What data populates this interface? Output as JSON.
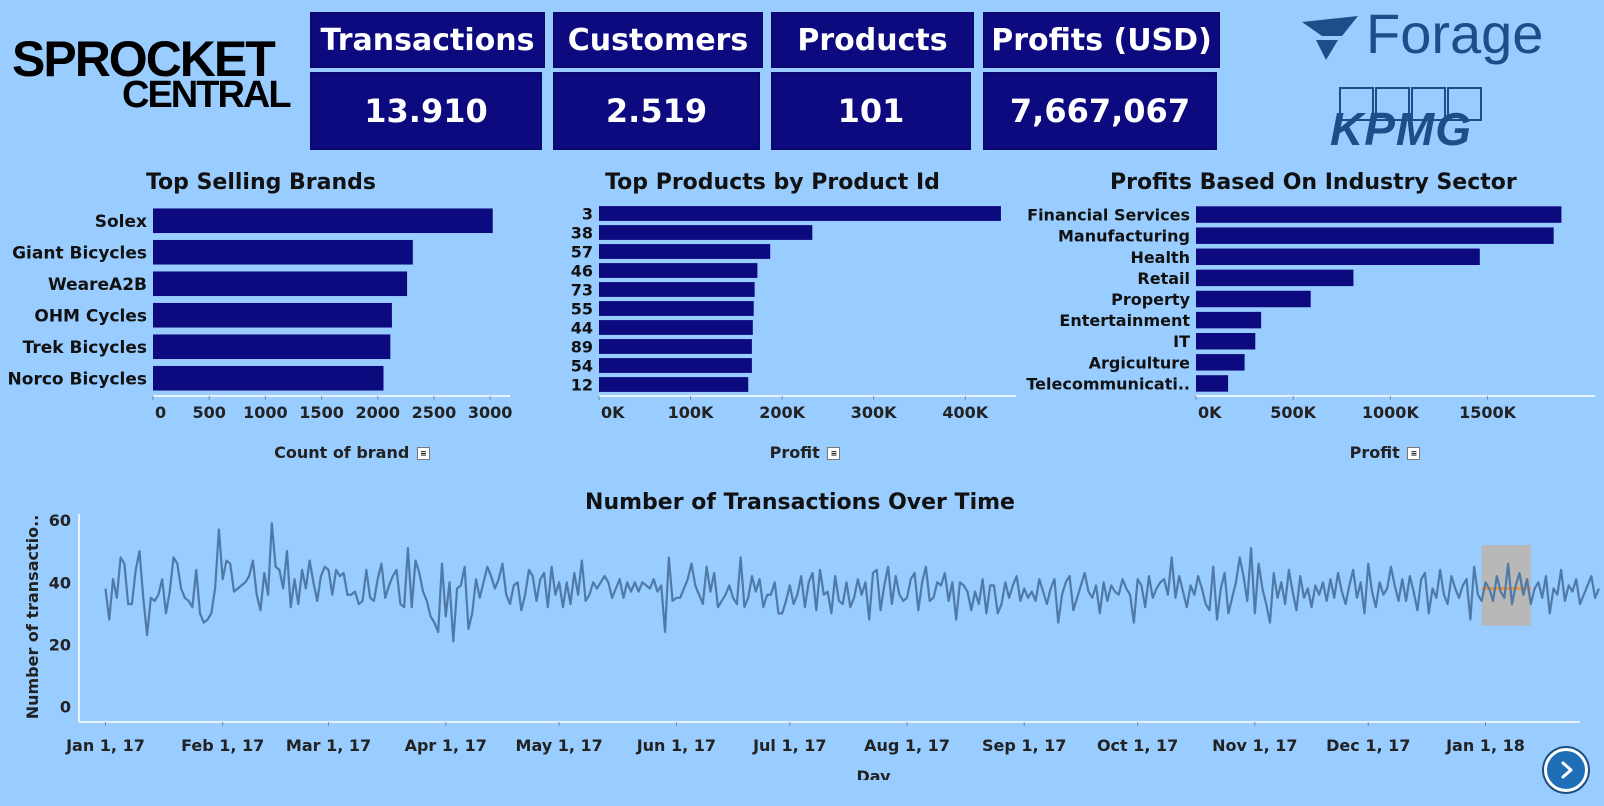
{
  "brand": {
    "line1": "SPROCKET",
    "line2": "CENTRAL",
    "forage": "Forage",
    "kpmg": "KPMG"
  },
  "kpis": [
    {
      "label": "Transactions",
      "value": "13.910"
    },
    {
      "label": "Customers",
      "value": "2.519"
    },
    {
      "label": "Products",
      "value": "101"
    },
    {
      "label": "Profits (USD)",
      "value": "7,667,067"
    }
  ],
  "colors": {
    "background": "#99ccff",
    "bar": "#0d0a80",
    "line": "#4f7aa6",
    "forecast_band": "#b8b8b8",
    "forecast_line": "#f28e2b"
  },
  "icons": {
    "nav": "chevron-right-icon",
    "sort": "sort-icon"
  },
  "chart_data": [
    {
      "type": "bar",
      "title": "Top Selling Brands",
      "xlabel": "Count of brand",
      "categories": [
        "Solex",
        "Giant Bicycles",
        "WeareA2B",
        "OHM Cycles",
        "Trek Bicycles",
        "Norco Bicycles"
      ],
      "values": [
        3023,
        2312,
        2261,
        2126,
        2112,
        2051
      ],
      "xlim": [
        0,
        3150
      ],
      "ticks": [
        0,
        500,
        1000,
        1500,
        2000,
        2500,
        3000
      ],
      "tick_labels": [
        "0",
        "500",
        "1000",
        "1500",
        "2000",
        "2500",
        "3000"
      ],
      "grid": false
    },
    {
      "type": "bar",
      "title": "Top Products by Product Id",
      "xlabel": "Profit",
      "categories": [
        "3",
        "38",
        "57",
        "46",
        "73",
        "55",
        "44",
        "89",
        "54",
        "12"
      ],
      "values": [
        439000,
        233000,
        187000,
        173000,
        170000,
        169000,
        168000,
        167000,
        167000,
        163000
      ],
      "xlim": [
        0,
        450000
      ],
      "ticks": [
        0,
        100000,
        200000,
        300000,
        400000
      ],
      "tick_labels": [
        "0K",
        "100K",
        "200K",
        "300K",
        "400K"
      ],
      "grid": false
    },
    {
      "type": "bar",
      "title": "Profits Based On Industry Sector",
      "xlabel": "Profit",
      "categories": [
        "Financial Services",
        "Manufacturing",
        "Health",
        "Retail",
        "Property",
        "Entertainment",
        "IT",
        "Argiculture",
        "Telecommunicati.."
      ],
      "values": [
        1880000,
        1840000,
        1460000,
        810000,
        590000,
        335000,
        305000,
        250000,
        165000
      ],
      "xlim": [
        0,
        1960000
      ],
      "ticks": [
        0,
        500000,
        1000000,
        1500000
      ],
      "tick_labels": [
        "0K",
        "500K",
        "1000K",
        "1500K"
      ],
      "grid": false
    },
    {
      "type": "line",
      "title": "Number of Transactions Over Time",
      "xlabel": "Day",
      "ylabel": "Number of transactio..",
      "ylim": [
        -5,
        62
      ],
      "yticks": [
        0,
        20,
        40,
        60
      ],
      "x_start": "2017-01-01",
      "x_tick_labels": [
        "Jan 1, 17",
        "Feb 1, 17",
        "Mar 1, 17",
        "Apr 1, 17",
        "May 1, 17",
        "Jun 1, 17",
        "Jul 1, 17",
        "Aug 1, 17",
        "Sep 1, 17",
        "Oct 1, 17",
        "Nov 1, 17",
        "Dec 1, 17",
        "Jan 1, 18"
      ],
      "x_tick_days": [
        0,
        31,
        59,
        90,
        120,
        151,
        181,
        212,
        243,
        273,
        304,
        334,
        365
      ],
      "xlim_days": [
        -7,
        390
      ],
      "forecast": {
        "start_day": 364,
        "end_day": 377,
        "value": 38,
        "low": 26,
        "high": 52
      },
      "values": [
        38,
        28,
        41,
        35,
        48,
        46,
        33,
        33,
        44,
        50,
        35,
        23,
        35,
        34,
        36,
        41,
        30,
        37,
        48,
        46,
        38,
        35,
        34,
        32,
        44,
        30,
        27,
        28,
        30,
        38,
        57,
        41,
        47,
        46,
        37,
        38,
        39,
        40,
        42,
        47,
        36,
        31,
        43,
        36,
        59,
        45,
        44,
        38,
        50,
        32,
        41,
        33,
        44,
        38,
        47,
        40,
        34,
        42,
        45,
        44,
        36,
        44,
        42,
        43,
        36,
        36,
        37,
        33,
        34,
        44,
        35,
        34,
        41,
        46,
        35,
        39,
        42,
        44,
        33,
        32,
        51,
        32,
        47,
        43,
        37,
        34,
        29,
        27,
        24,
        46,
        29,
        40,
        21,
        38,
        39,
        45,
        25,
        30,
        41,
        35,
        40,
        45,
        42,
        38,
        41,
        46,
        36,
        33,
        39,
        40,
        31,
        36,
        44,
        42,
        34,
        41,
        43,
        32,
        45,
        36,
        40,
        32,
        40,
        33,
        43,
        36,
        47,
        34,
        36,
        40,
        38,
        40,
        42,
        40,
        35,
        38,
        41,
        35,
        40,
        37,
        40,
        37,
        40,
        39,
        38,
        41,
        37,
        39,
        24,
        48,
        34,
        35,
        35,
        38,
        41,
        46,
        39,
        36,
        33,
        45,
        37,
        43,
        32,
        34,
        36,
        39,
        35,
        33,
        48,
        32,
        35,
        42,
        37,
        41,
        32,
        36,
        36,
        40,
        30,
        30,
        34,
        39,
        33,
        36,
        42,
        32,
        40,
        43,
        31,
        44,
        36,
        37,
        30,
        42,
        34,
        33,
        40,
        32,
        35,
        41,
        36,
        40,
        28,
        43,
        44,
        31,
        39,
        45,
        33,
        42,
        36,
        34,
        35,
        41,
        43,
        31,
        40,
        45,
        34,
        35,
        40,
        39,
        43,
        34,
        40,
        28,
        40,
        39,
        37,
        31,
        37,
        33,
        41,
        30,
        39,
        39,
        30,
        33,
        40,
        35,
        39,
        42,
        34,
        38,
        35,
        37,
        34,
        41,
        37,
        33,
        38,
        41,
        27,
        36,
        40,
        42,
        31,
        35,
        39,
        43,
        37,
        35,
        39,
        30,
        40,
        34,
        39,
        37,
        36,
        41,
        38,
        36,
        27,
        41,
        39,
        32,
        42,
        35,
        38,
        40,
        41,
        36,
        48,
        35,
        42,
        37,
        32,
        39,
        36,
        42,
        38,
        33,
        31,
        45,
        28,
        38,
        43,
        30,
        35,
        40,
        48,
        42,
        34,
        51,
        30,
        46,
        38,
        33,
        27,
        43,
        35,
        40,
        33,
        44,
        37,
        31,
        42,
        35,
        38,
        32,
        39,
        36,
        40,
        34,
        41,
        35,
        43,
        37,
        33,
        39,
        44,
        35,
        40,
        30,
        46,
        37,
        32,
        40,
        36,
        38,
        45,
        39,
        34,
        41,
        34,
        42,
        37,
        31,
        41,
        43,
        30,
        38,
        35,
        44,
        36,
        33,
        42,
        38,
        35,
        39,
        41,
        28,
        45,
        36,
        34,
        40,
        38,
        34,
        42,
        37,
        35,
        46,
        33,
        39,
        43,
        36,
        41,
        33,
        38,
        40,
        35,
        42,
        30,
        38,
        36,
        44,
        34,
        39,
        37,
        41,
        33,
        36,
        39,
        42,
        35,
        38
      ]
    }
  ]
}
